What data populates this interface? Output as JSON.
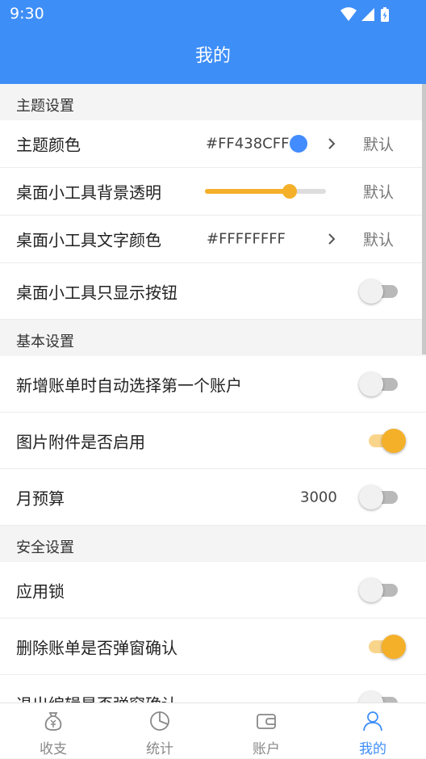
{
  "status_bar": {
    "time": "9:30"
  },
  "app_bar": {
    "title": "我的"
  },
  "colors": {
    "primary": "#3e8ef7",
    "accent": "#f5b02a",
    "theme_dot": "#438CFF"
  },
  "sections": {
    "theme": {
      "header": "主题设置",
      "theme_color": {
        "label": "主题颜色",
        "value": "#FF438CFF",
        "reset": "默认"
      },
      "widget_bg_alpha": {
        "label": "桌面小工具背景透明",
        "slider_level": 0.7,
        "reset": "默认"
      },
      "widget_text_color": {
        "label": "桌面小工具文字颜色",
        "value": "#FFFFFFFF",
        "reset": "默认"
      },
      "widget_buttons_only": {
        "label": "桌面小工具只显示按钮",
        "enabled": false
      }
    },
    "basic": {
      "header": "基本设置",
      "auto_select_account": {
        "label": "新增账单时自动选择第一个账户",
        "enabled": false
      },
      "image_attachments": {
        "label": "图片附件是否启用",
        "enabled": true
      },
      "monthly_budget": {
        "label": "月预算",
        "value": "3000",
        "enabled": false
      }
    },
    "security": {
      "header": "安全设置",
      "app_lock": {
        "label": "应用锁",
        "enabled": false
      },
      "delete_confirm": {
        "label": "删除账单是否弹窗确认",
        "enabled": true
      },
      "exit_edit_confirm": {
        "label": "退出编辑是否弹窗确认",
        "enabled": false
      }
    }
  },
  "bottom_nav": [
    {
      "label": "收支",
      "icon": "money-bag-icon",
      "active": false
    },
    {
      "label": "统计",
      "icon": "pie-chart-icon",
      "active": false
    },
    {
      "label": "账户",
      "icon": "wallet-icon",
      "active": false
    },
    {
      "label": "我的",
      "icon": "person-icon",
      "active": true
    }
  ]
}
